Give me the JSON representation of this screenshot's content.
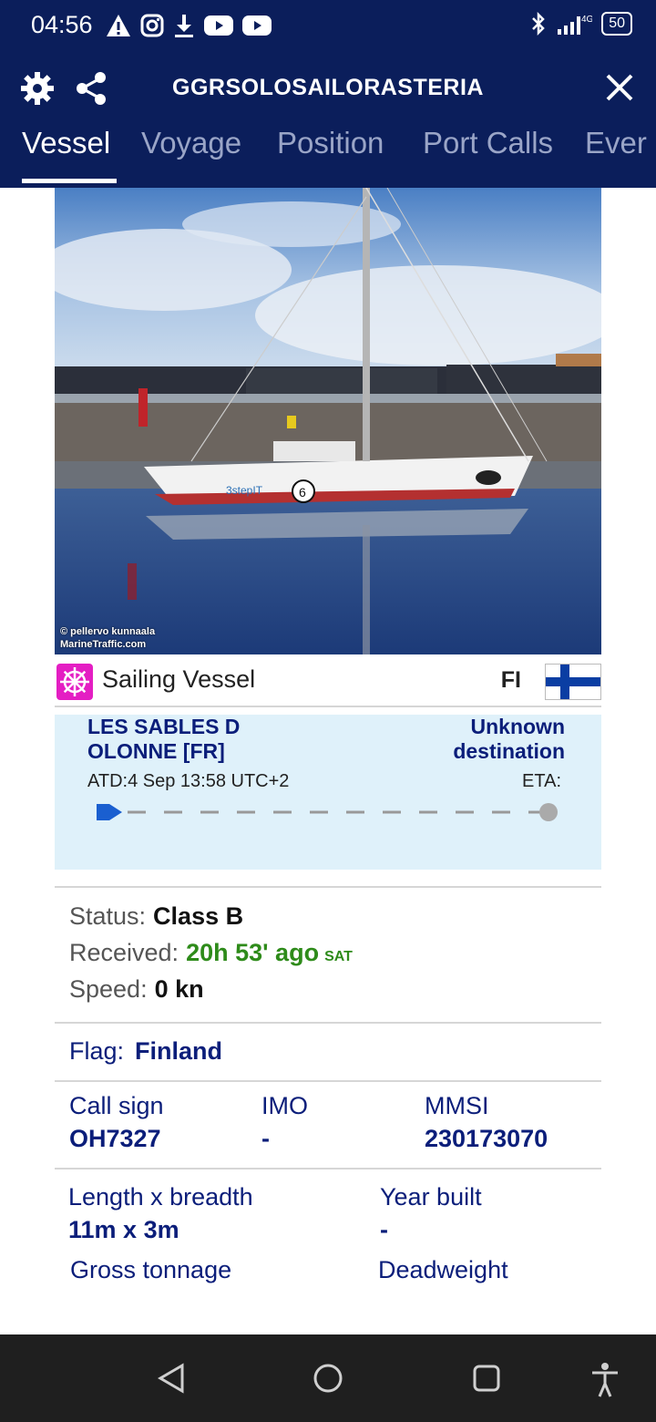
{
  "statusbar": {
    "time": "04:56",
    "network": "4G",
    "battery": "50",
    "left_icons": [
      "warning-icon",
      "instagram-icon",
      "download-icon",
      "youtube-icon",
      "youtube-icon"
    ],
    "right_icons": [
      "bluetooth-icon",
      "signal-icon",
      "battery-icon"
    ]
  },
  "appbar": {
    "title": "GGRSOLOSAILORASTERIA",
    "tabs": [
      {
        "label": "Vessel",
        "active": true
      },
      {
        "label": "Voyage",
        "active": false
      },
      {
        "label": "Position",
        "active": false
      },
      {
        "label": "Port Calls",
        "active": false
      },
      {
        "label": "Ever",
        "active": false
      }
    ]
  },
  "photo": {
    "credit_line1": "© pellervo kunnaala",
    "credit_line2": "MarineTraffic.com",
    "hull_text": "3stepIT",
    "sail_number": "6"
  },
  "vessel": {
    "type_label": "Sailing Vessel",
    "flag_code": "FI",
    "type_icon_color": "#e41ec3"
  },
  "voyage": {
    "origin": "LES SABLES D OLONNE [FR]",
    "destination": "Unknown destination",
    "atd_label": "ATD:",
    "atd_value": "4 Sep 13:58 UTC+2",
    "eta_label": "ETA:",
    "eta_value": ""
  },
  "status": {
    "status_label": "Status:",
    "status_value": "Class B",
    "received_label": "Received:",
    "received_value": "20h 53' ago",
    "received_source": "SAT",
    "speed_label": "Speed:",
    "speed_value": "0 kn"
  },
  "flag": {
    "label": "Flag:",
    "value": "Finland"
  },
  "ids": {
    "callsign_label": "Call sign",
    "callsign_value": "OH7327",
    "imo_label": "IMO",
    "imo_value": "-",
    "mmsi_label": "MMSI",
    "mmsi_value": "230173070"
  },
  "dimensions": {
    "length_label": "Length x breadth",
    "length_value": "11m x 3m",
    "year_label": "Year built",
    "year_value": "-",
    "gross_label": "Gross tonnage",
    "deadweight_label": "Deadweight"
  },
  "colors": {
    "header_bg": "#0b1e5b",
    "accent_blue": "#0b1e7a",
    "received_green": "#2e8b1a",
    "voyage_bg": "#dff1fa"
  }
}
